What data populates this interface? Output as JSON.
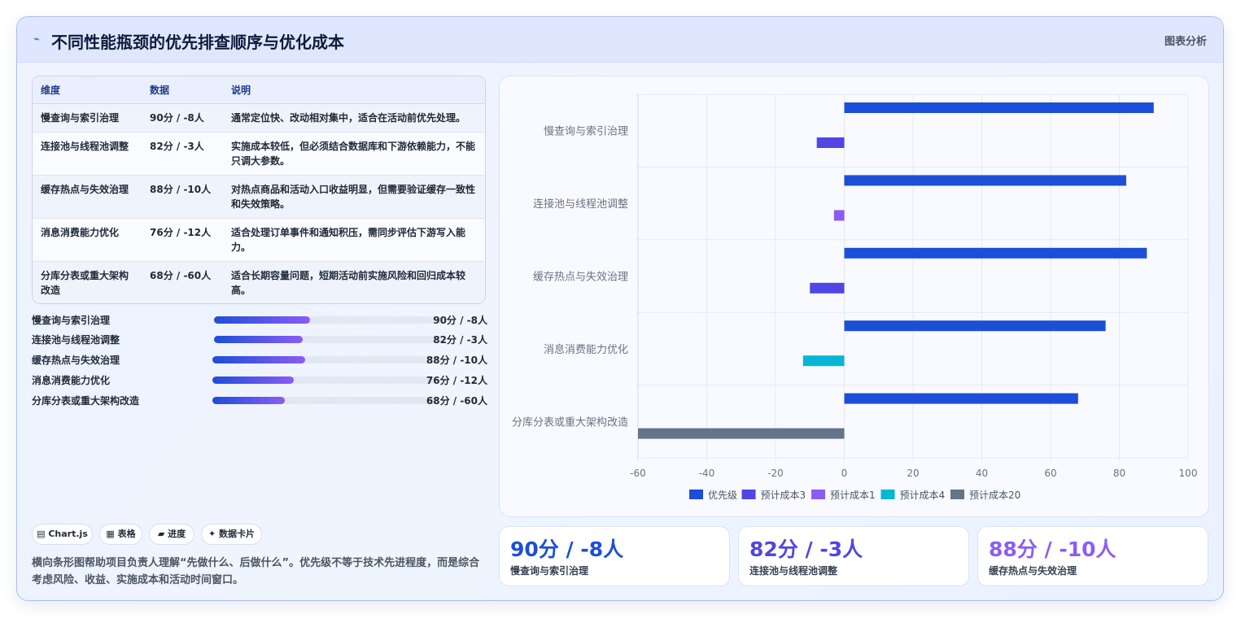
{
  "header": {
    "title": "不同性能瓶颈的优先排查顺序与优化成本",
    "link": "图表分析",
    "icon": "sparkline-icon"
  },
  "table": {
    "headers": [
      "维度",
      "数据",
      "说明"
    ],
    "rows": [
      {
        "dim": "慢查询与索引治理",
        "data": "90分 / -8人",
        "desc": "通常定位快、改动相对集中，适合在活动前优先处理。"
      },
      {
        "dim": "连接池与线程池调整",
        "data": "82分 / -3人",
        "desc": "实施成本较低，但必须结合数据库和下游依赖能力，不能只调大参数。"
      },
      {
        "dim": "缓存热点与失效治理",
        "data": "88分 / -10人",
        "desc": "对热点商品和活动入口收益明显，但需要验证缓存一致性和失效策略。"
      },
      {
        "dim": "消息消费能力优化",
        "data": "76分 / -12人",
        "desc": "适合处理订单事件和通知积压，需同步评估下游写入能力。"
      },
      {
        "dim": "分库分表或重大架构改造",
        "data": "68分 / -60人",
        "desc": "适合长期容量问题，短期活动前实施风险和回归成本较高。"
      }
    ]
  },
  "progress": [
    {
      "name": "慢查询与索引治理",
      "value": "90分 / -8人",
      "pct": 42
    },
    {
      "name": "连接池与线程池调整",
      "value": "82分 / -3人",
      "pct": 39
    },
    {
      "name": "缓存热点与失效治理",
      "value": "88分 / -10人",
      "pct": 41
    },
    {
      "name": "消息消费能力优化",
      "value": "76分 / -12人",
      "pct": 36
    },
    {
      "name": "分库分表或重大架构改造",
      "value": "68分 / -60人",
      "pct": 32
    }
  ],
  "chips": [
    {
      "icon": "chart-icon",
      "glyph": "▤",
      "label": "Chart.js"
    },
    {
      "icon": "table-icon",
      "glyph": "▦",
      "label": "表格"
    },
    {
      "icon": "progress-icon",
      "glyph": "▰",
      "label": "进度"
    },
    {
      "icon": "card-icon",
      "glyph": "✦",
      "label": "数据卡片"
    }
  ],
  "note": "横向条形图帮助项目负责人理解“先做什么、后做什么”。优先级不等于技术先进程度，而是综合考虑风险、收益、实施成本和活动时间窗口。",
  "stats": [
    {
      "value": "90分 / -8人",
      "label": "慢查询与索引治理",
      "color": "#1d4ed8"
    },
    {
      "value": "82分 / -3人",
      "label": "连接池与线程池调整",
      "color": "#4f46e5"
    },
    {
      "value": "88分 / -10人",
      "label": "缓存热点与失效治理",
      "color": "#8b5cf6"
    }
  ],
  "chart_data": {
    "type": "bar",
    "orientation": "horizontal",
    "categories": [
      "慢查询与索引治理",
      "连接池与线程池调整",
      "缓存热点与失效治理",
      "消息消费能力优化",
      "分库分表或重大架构改造"
    ],
    "series": [
      {
        "name": "优先级",
        "color": "#1d4ed8",
        "values": [
          90,
          82,
          88,
          76,
          68
        ]
      },
      {
        "name": "预计成本3",
        "color": "#4f46e5",
        "values": [
          -8,
          null,
          -10,
          null,
          null
        ]
      },
      {
        "name": "预计成本1",
        "color": "#8b5cf6",
        "values": [
          null,
          -3,
          null,
          null,
          null
        ]
      },
      {
        "name": "预计成本4",
        "color": "#06b6d4",
        "values": [
          null,
          null,
          null,
          -12,
          null
        ]
      },
      {
        "name": "预计成本20",
        "color": "#64748b",
        "values": [
          null,
          null,
          null,
          null,
          -60
        ]
      }
    ],
    "xlim": [
      -60,
      100
    ],
    "xticks": [
      -60,
      -40,
      -20,
      0,
      20,
      40,
      60,
      80,
      100
    ],
    "grid": true,
    "legend": "bottom"
  }
}
